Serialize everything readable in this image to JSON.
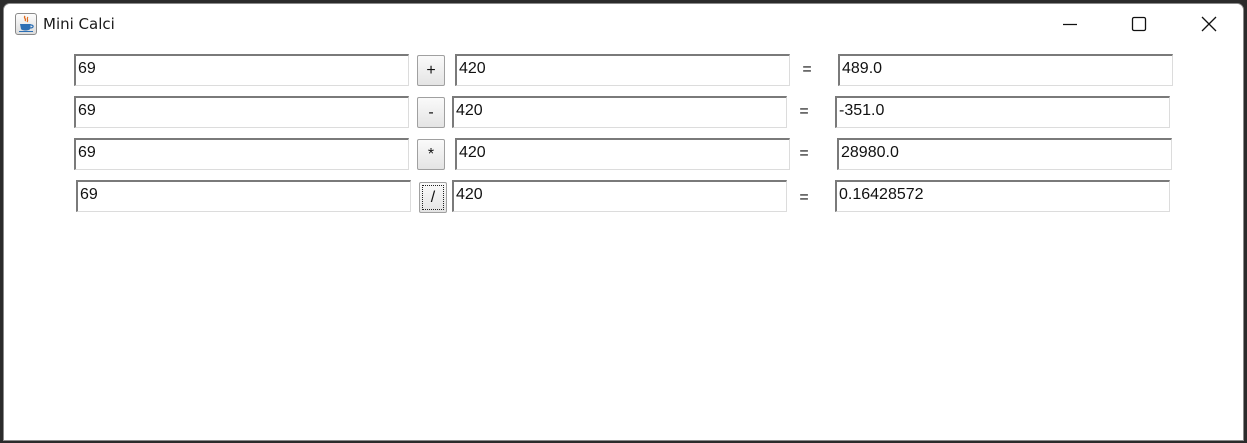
{
  "window": {
    "title": "Mini Calci",
    "app_icon": "java-coffee-cup-icon"
  },
  "controls": {
    "minimize_icon": "minimize-icon",
    "maximize_icon": "maximize-icon",
    "close_icon": "close-icon"
  },
  "rows": [
    {
      "a": "69",
      "op": "+",
      "b": "420",
      "eq": "=",
      "result": "489.0"
    },
    {
      "a": "69",
      "op": "-",
      "b": "420",
      "eq": "=",
      "result": "-351.0"
    },
    {
      "a": "69",
      "op": "*",
      "b": "420",
      "eq": "=",
      "result": "28980.0"
    },
    {
      "a": "69",
      "op": "/",
      "b": "420",
      "eq": "=",
      "result": "0.16428572"
    }
  ]
}
